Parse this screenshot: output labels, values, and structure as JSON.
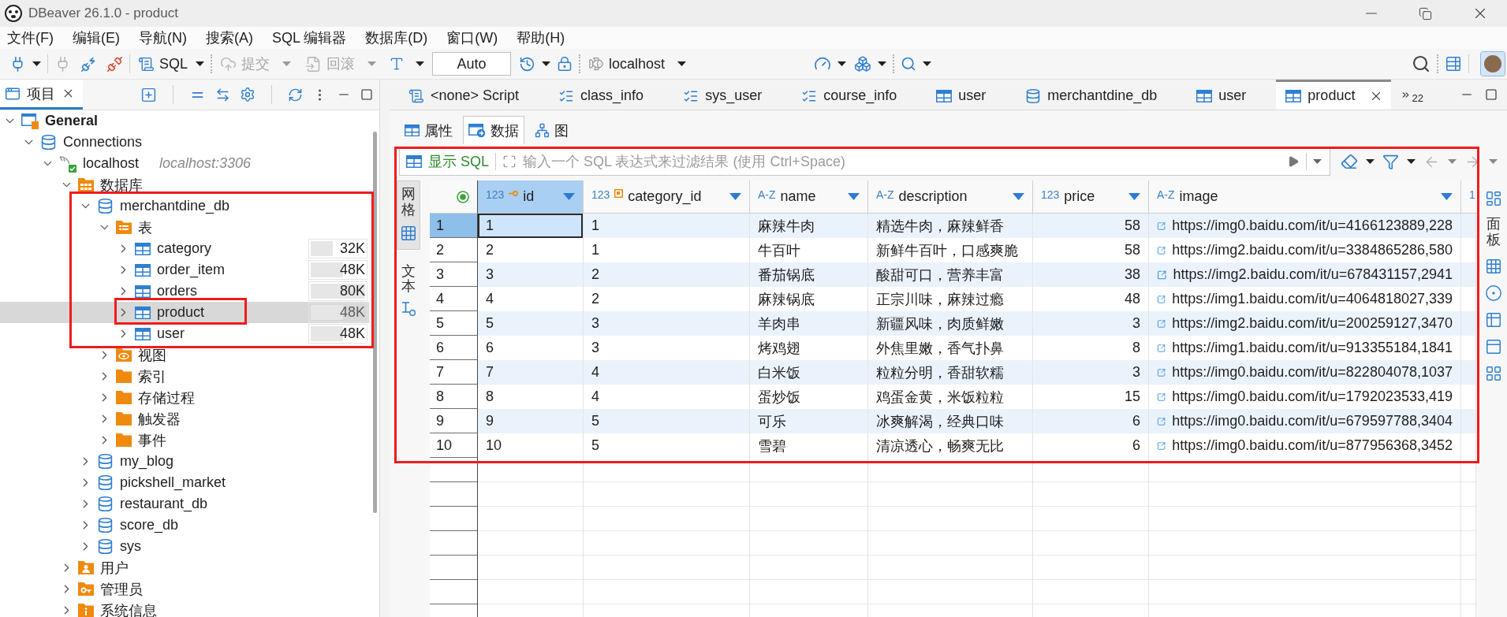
{
  "window": {
    "title": "DBeaver 26.1.0 - product"
  },
  "menu": [
    "文件(F)",
    "编辑(E)",
    "导航(N)",
    "搜索(A)",
    "SQL 编辑器",
    "数据库(D)",
    "窗口(W)",
    "帮助(H)"
  ],
  "toolbar": {
    "sql": {
      "label": "SQL"
    },
    "commit": {
      "label": "提交",
      "disabled": true
    },
    "rollback": {
      "label": "回滚",
      "disabled": true
    },
    "transaction_mode": {
      "value": "Auto"
    },
    "connection": {
      "label": "localhost"
    }
  },
  "project_panel": {
    "tab": {
      "label": "项目",
      "selected": true
    },
    "tree": [
      {
        "label": "General",
        "kind": "project",
        "expanded": true,
        "selected": false,
        "children": [
          {
            "label": "Connections",
            "kind": "connections",
            "expanded": true,
            "selected": false,
            "children": [
              {
                "label": "localhost",
                "detail": "localhost:3306",
                "kind": "server",
                "expanded": true,
                "selected": false,
                "children": [
                  {
                    "label": "数据库",
                    "kind": "databases",
                    "expanded": true,
                    "selected": false,
                    "children": [
                      {
                        "label": "merchantdine_db",
                        "kind": "database",
                        "expanded": true,
                        "selected": false,
                        "children": [
                          {
                            "label": "表",
                            "kind": "tables",
                            "expanded": true,
                            "selected": false,
                            "children": [
                              {
                                "label": "category",
                                "kind": "table",
                                "size": "32K",
                                "level": 0.4,
                                "expanded": false,
                                "selected": false
                              },
                              {
                                "label": "order_item",
                                "kind": "table",
                                "size": "48K",
                                "level": 0.6,
                                "expanded": false,
                                "selected": false
                              },
                              {
                                "label": "orders",
                                "kind": "table",
                                "size": "80K",
                                "level": 1,
                                "expanded": false,
                                "selected": false
                              },
                              {
                                "label": "product",
                                "kind": "table",
                                "size": "48K",
                                "level": 0.6,
                                "expanded": false,
                                "selected": true
                              },
                              {
                                "label": "user",
                                "kind": "table",
                                "size": "48K",
                                "level": 0.6,
                                "expanded": false,
                                "selected": false
                              }
                            ]
                          },
                          {
                            "label": "视图",
                            "kind": "views",
                            "expanded": false,
                            "selected": false
                          },
                          {
                            "label": "索引",
                            "kind": "folder",
                            "expanded": false,
                            "selected": false
                          },
                          {
                            "label": "存储过程",
                            "kind": "folder",
                            "expanded": false,
                            "selected": false
                          },
                          {
                            "label": "触发器",
                            "kind": "folder",
                            "expanded": false,
                            "selected": false
                          },
                          {
                            "label": "事件",
                            "kind": "folder",
                            "expanded": false,
                            "selected": false
                          }
                        ]
                      },
                      {
                        "label": "my_blog",
                        "kind": "database",
                        "expanded": false,
                        "selected": false
                      },
                      {
                        "label": "pickshell_market",
                        "kind": "database",
                        "expanded": false,
                        "selected": false
                      },
                      {
                        "label": "restaurant_db",
                        "kind": "database",
                        "expanded": false,
                        "selected": false
                      },
                      {
                        "label": "score_db",
                        "kind": "database",
                        "expanded": false,
                        "selected": false
                      },
                      {
                        "label": "sys",
                        "kind": "database",
                        "expanded": false,
                        "selected": false
                      }
                    ]
                  },
                  {
                    "label": "用户",
                    "kind": "users",
                    "expanded": false,
                    "selected": false
                  },
                  {
                    "label": "管理员",
                    "kind": "admins",
                    "expanded": false,
                    "selected": false
                  },
                  {
                    "label": "系统信息",
                    "kind": "info",
                    "expanded": false,
                    "selected": false
                  }
                ]
              }
            ]
          }
        ]
      }
    ]
  },
  "editor_tabs": [
    {
      "label": "<none> Script",
      "kind": "script",
      "selected": false
    },
    {
      "label": "class_info",
      "kind": "query",
      "selected": false
    },
    {
      "label": "sys_user",
      "kind": "query",
      "selected": false
    },
    {
      "label": "course_info",
      "kind": "query",
      "selected": false
    },
    {
      "label": "user",
      "kind": "table",
      "selected": false
    },
    {
      "label": "merchantdine_db",
      "kind": "database",
      "selected": false
    },
    {
      "label": "user",
      "kind": "table",
      "selected": false
    },
    {
      "label": "product",
      "kind": "table",
      "selected": true
    }
  ],
  "more_tabs": {
    "count": "22"
  },
  "view_tabs": [
    {
      "label": "属性",
      "selected": false
    },
    {
      "label": "数据",
      "selected": true
    },
    {
      "label": "图",
      "selected": false
    }
  ],
  "results": {
    "filter": {
      "show_sql": "显示 SQL",
      "placeholder": "输入一个 SQL 表达式来过滤结果 (使用 Ctrl+Space)"
    },
    "view_modes": [
      {
        "label": "网格",
        "selected": true
      },
      {
        "label": "文本",
        "selected": false
      }
    ],
    "columns": [
      {
        "name": "id",
        "type_label": "123",
        "kind": "primary_key",
        "selected": true
      },
      {
        "name": "category_id",
        "type_label": "123",
        "kind": "foreign_key",
        "selected": false
      },
      {
        "name": "name",
        "type_label": "A-Z",
        "kind": "text",
        "selected": false
      },
      {
        "name": "description",
        "type_label": "A-Z",
        "kind": "text",
        "selected": false
      },
      {
        "name": "price",
        "type_label": "123",
        "kind": "number",
        "selected": false
      },
      {
        "name": "image",
        "type_label": "A-Z",
        "kind": "link",
        "selected": false
      },
      {
        "type_label": "1",
        "kind": "number",
        "selected": false
      }
    ],
    "rows": [
      {
        "number": "1",
        "selected": true,
        "cells": [
          "1",
          "1",
          "麻辣牛肉",
          "精选牛肉，麻辣鲜香",
          "58",
          "https://img0.baidu.com/it/u=4166123889,228"
        ]
      },
      {
        "number": "2",
        "selected": false,
        "cells": [
          "2",
          "1",
          "牛百叶",
          "新鲜牛百叶，口感爽脆",
          "58",
          "https://img2.baidu.com/it/u=3384865286,580"
        ]
      },
      {
        "number": "3",
        "selected": false,
        "cells": [
          "3",
          "2",
          "番茄锅底",
          "酸甜可口，营养丰富",
          "38",
          "https://img2.baidu.com/it/u=678431157,2941"
        ]
      },
      {
        "number": "4",
        "selected": false,
        "cells": [
          "4",
          "2",
          "麻辣锅底",
          "正宗川味，麻辣过瘾",
          "48",
          "https://img1.baidu.com/it/u=4064818027,339"
        ]
      },
      {
        "number": "5",
        "selected": false,
        "cells": [
          "5",
          "3",
          "羊肉串",
          "新疆风味，肉质鲜嫩",
          "3",
          "https://img2.baidu.com/it/u=200259127,3470"
        ]
      },
      {
        "number": "6",
        "selected": false,
        "cells": [
          "6",
          "3",
          "烤鸡翅",
          "外焦里嫩，香气扑鼻",
          "8",
          "https://img1.baidu.com/it/u=913355184,1841"
        ]
      },
      {
        "number": "7",
        "selected": false,
        "cells": [
          "7",
          "4",
          "白米饭",
          "粒粒分明，香甜软糯",
          "3",
          "https://img0.baidu.com/it/u=822804078,1037"
        ]
      },
      {
        "number": "8",
        "selected": false,
        "cells": [
          "8",
          "4",
          "蛋炒饭",
          "鸡蛋金黄，米饭粒粒",
          "15",
          "https://img0.baidu.com/it/u=1792023533,419"
        ]
      },
      {
        "number": "9",
        "selected": false,
        "cells": [
          "9",
          "5",
          "可乐",
          "冰爽解渴，经典口味",
          "6",
          "https://img0.baidu.com/it/u=679597788,3404"
        ]
      },
      {
        "number": "10",
        "selected": false,
        "cells": [
          "10",
          "5",
          "雪碧",
          "清凉透心，畅爽无比",
          "6",
          "https://img0.baidu.com/it/u=877956368,3452"
        ]
      }
    ]
  },
  "side_panel": {
    "label": "面板"
  },
  "annotations": [
    {
      "kind": "frame"
    },
    {
      "kind": "frame"
    },
    {
      "kind": "frame"
    }
  ]
}
